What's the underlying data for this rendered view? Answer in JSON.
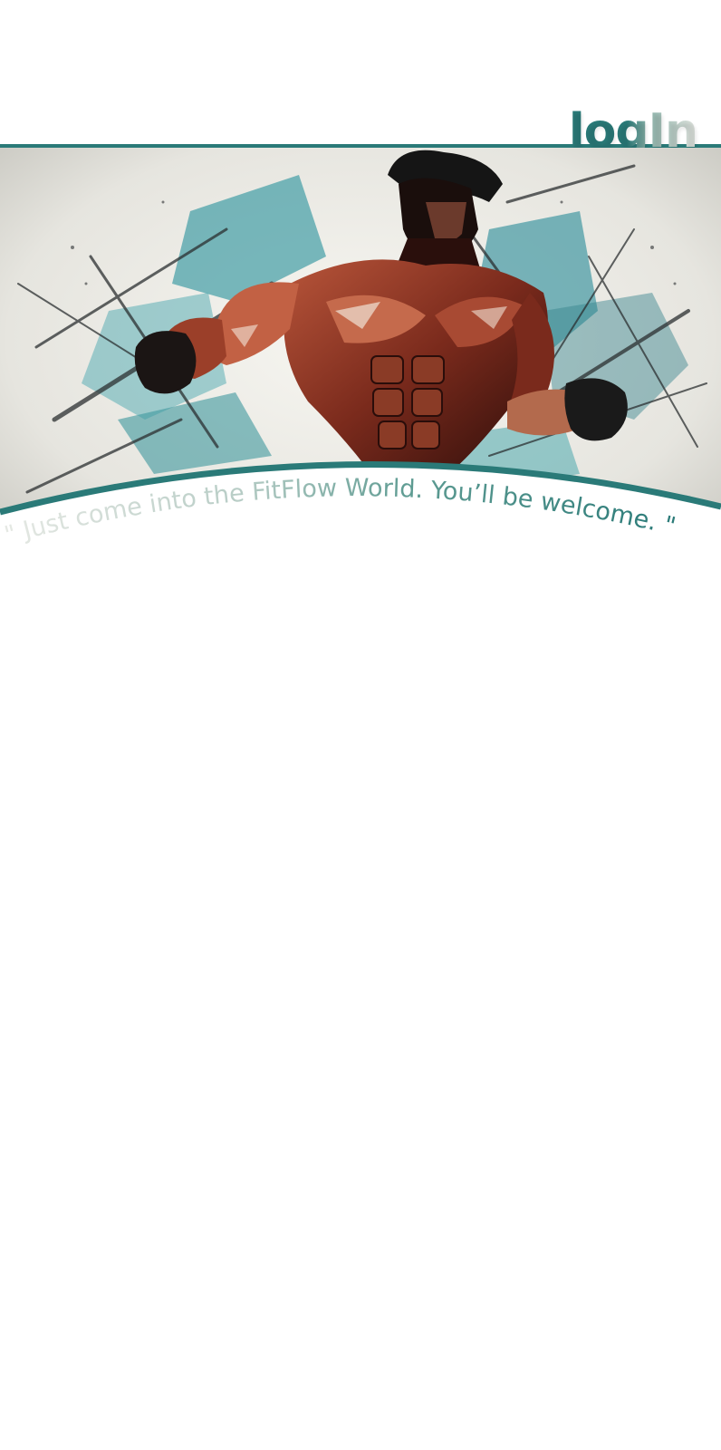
{
  "header": {
    "login_label": "logIn"
  },
  "hero": {
    "image_alt": "Illustration of a muscular man flexing with teal brush strokes",
    "quote": "\" Just come into the FitFlow World. You’ll be welcome. \""
  },
  "colors": {
    "accent": "#2a7a78",
    "accent_light": "#8fb4ab",
    "accent_pale": "#dfe4de",
    "background": "#ffffff"
  }
}
